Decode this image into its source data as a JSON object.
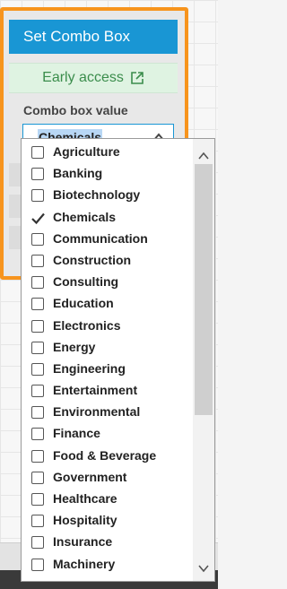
{
  "panel": {
    "title": "Set Combo Box",
    "early_access": {
      "label": "Early access",
      "icon": "external-link-icon"
    },
    "combo_label": "Combo box value",
    "combo_value": "Chemicals"
  },
  "dropdown": {
    "options": [
      {
        "label": "Agriculture",
        "checked": false
      },
      {
        "label": "Banking",
        "checked": false
      },
      {
        "label": "Biotechnology",
        "checked": false
      },
      {
        "label": "Chemicals",
        "checked": true
      },
      {
        "label": "Communication",
        "checked": false
      },
      {
        "label": "Construction",
        "checked": false
      },
      {
        "label": "Consulting",
        "checked": false
      },
      {
        "label": "Education",
        "checked": false
      },
      {
        "label": "Electronics",
        "checked": false
      },
      {
        "label": "Energy",
        "checked": false
      },
      {
        "label": "Engineering",
        "checked": false
      },
      {
        "label": "Entertainment",
        "checked": false
      },
      {
        "label": "Environmental",
        "checked": false
      },
      {
        "label": "Finance",
        "checked": false
      },
      {
        "label": "Food & Beverage",
        "checked": false
      },
      {
        "label": "Government",
        "checked": false
      },
      {
        "label": "Healthcare",
        "checked": false
      },
      {
        "label": "Hospitality",
        "checked": false
      },
      {
        "label": "Insurance",
        "checked": false
      },
      {
        "label": "Machinery",
        "checked": false
      }
    ]
  },
  "colors": {
    "header": "#1996d4",
    "panel_border": "#f7941d",
    "early_access_bg": "#dff3e2",
    "early_access_text": "#3b8d4c",
    "selection_highlight": "#b8d7f5"
  }
}
